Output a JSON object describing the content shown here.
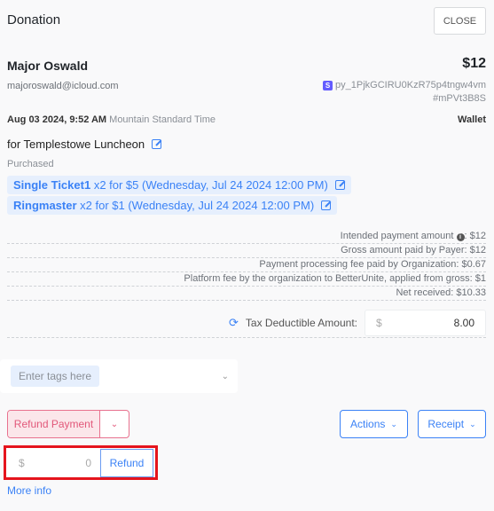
{
  "header": {
    "title": "Donation",
    "close_label": "CLOSE"
  },
  "donor": {
    "name": "Major Oswald",
    "email": "majoroswald@icloud.com",
    "amount": "$12",
    "payment_id": "py_1PjkGCIRU0KzR75p4tngw4vm",
    "reference": "#mPVt3B8S",
    "stripe_icon": "S"
  },
  "date": {
    "datetime": "Aug 03 2024, 9:52 AM",
    "timezone": "Mountain Standard Time",
    "method": "Wallet"
  },
  "campaign": {
    "label": "for Templestowe Luncheon"
  },
  "purchased": {
    "label": "Purchased",
    "items": [
      {
        "name": "Single Ticket1",
        "detail": "x2 for $5 (Wednesday, Jul 24 2024 12:00 PM)"
      },
      {
        "name": "Ringmaster",
        "detail": "x2 for $1 (Wednesday, Jul 24 2024 12:00 PM)"
      }
    ]
  },
  "summary": {
    "intended_label": "Intended payment amount",
    "intended_value": ": $12",
    "rows": [
      "Gross amount paid by Payer: $12",
      "Payment processing fee paid by Organization: $0.67",
      "Platform fee by the organization to BetterUnite, applied from gross: $1",
      "Net received: $10.33"
    ]
  },
  "tax": {
    "label": "Tax Deductible Amount:",
    "currency": "$",
    "value": "8.00"
  },
  "tags": {
    "placeholder": "Enter tags here"
  },
  "actions": {
    "refund_payment": "Refund Payment",
    "actions": "Actions",
    "receipt": "Receipt"
  },
  "refund": {
    "currency": "$",
    "value": "0",
    "button": "Refund"
  },
  "more_info": "More info",
  "colors": {
    "accent": "#3b82f6",
    "danger": "#e2587a",
    "highlight": "#e5141d"
  }
}
